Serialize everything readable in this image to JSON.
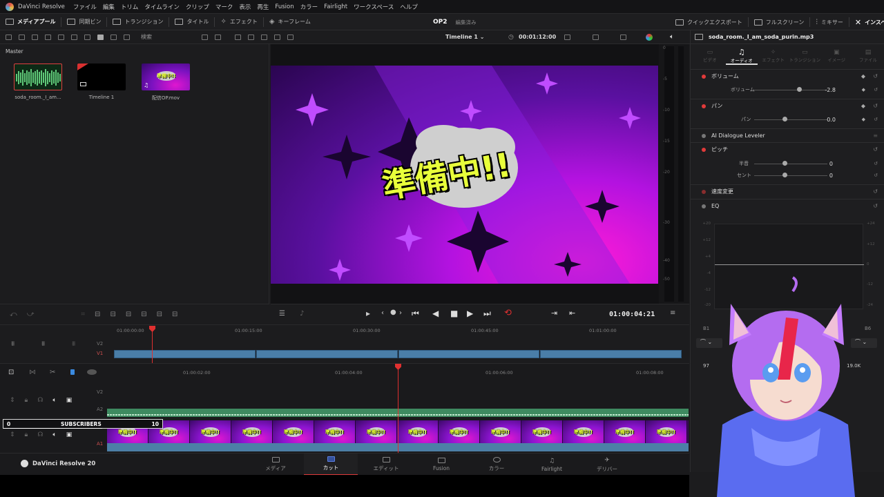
{
  "menu": {
    "app_name": "DaVinci Resolve",
    "items": [
      "ファイル",
      "編集",
      "トリム",
      "タイムライン",
      "クリップ",
      "マーク",
      "表示",
      "再生",
      "Fusion",
      "カラー",
      "Fairlight",
      "ワークスペース",
      "ヘルプ"
    ]
  },
  "toolbar": {
    "media_pool": "メディアプール",
    "sync_bin": "同期ビン",
    "transitions": "トランジション",
    "titles": "タイトル",
    "effects": "エフェクト",
    "keyframes": "キーフレーム",
    "project_name": "OP2",
    "project_status": "編集済み",
    "quick_export": "クイックエクスポート",
    "fullscreen": "フルスクリーン",
    "mixer": "ミキサー",
    "inspector": "インスペクタ"
  },
  "search": {
    "placeholder": "検索"
  },
  "viewer": {
    "timeline_name": "Timeline 1",
    "timecode": "00:01:12:00",
    "playhead_timecode": "01:00:04:21"
  },
  "media_pool": {
    "bin": "Master",
    "items": [
      {
        "name": "soda_room._I_am..."
      },
      {
        "name": "Timeline 1"
      },
      {
        "name": "配信OP.mov"
      }
    ]
  },
  "video": {
    "headline": "準備中!!"
  },
  "meter_scale": [
    "0",
    "-5",
    "-10",
    "-15",
    "-20",
    "-30",
    "-40",
    "-50"
  ],
  "inspector": {
    "filename": "soda_room._I_am_soda_purin.mp3",
    "tabs": [
      "ビデオ",
      "オーディオ",
      "エフェクト",
      "トランジション",
      "イメージ",
      "ファイル"
    ],
    "active_tab": "オーディオ",
    "volume": {
      "title": "ボリューム",
      "label": "ボリューム",
      "value": "-2.8"
    },
    "pan": {
      "title": "パン",
      "label": "パン",
      "value": "0.0"
    },
    "dialogue": {
      "title": "AI Dialogue Leveler"
    },
    "pitch": {
      "title": "ピッチ",
      "semitone_label": "半音",
      "semitone_value": "0",
      "cents_label": "セント",
      "cents_value": "0"
    },
    "speed": {
      "title": "速度変更"
    },
    "eq": {
      "title": "EQ",
      "left_scale": [
        "+20",
        "+12",
        "+4",
        "-4",
        "-12",
        "-20"
      ],
      "right_scale": [
        "+24",
        "+12",
        "0",
        "-12",
        "-24"
      ],
      "bands": [
        "B1",
        "B6"
      ],
      "band_values": [
        "97",
        "19.0K"
      ]
    }
  },
  "timeline": {
    "upper_ruler": [
      "01:00:00:00",
      "01:00:15:00",
      "01:00:30:00",
      "01:00:45:00",
      "01:01:00:00"
    ],
    "lower_ruler": [
      "01:00:02:00",
      "01:00:04:00",
      "01:00:06:00",
      "01:00:08:00"
    ],
    "tracks": {
      "v2": "V2",
      "v1": "V1",
      "a2": "A2",
      "a1": "A1"
    },
    "film_label": "準備中!!"
  },
  "subscribers": {
    "label": "SUBSCRIBERS",
    "min": "0",
    "max": "10",
    "progress": 0.62
  },
  "pages": {
    "brand": "DaVinci Resolve 20",
    "items": [
      "メディア",
      "カット",
      "エディット",
      "Fusion",
      "カラー",
      "Fairlight",
      "デリバー"
    ],
    "active": "カット"
  },
  "colors": {
    "accent_red": "#e03030",
    "clip_blue": "#4a7ea8",
    "audio_green": "#3e8a60",
    "video_purple": "#9b14e0",
    "headline_yellow": "#e8ff3a"
  }
}
